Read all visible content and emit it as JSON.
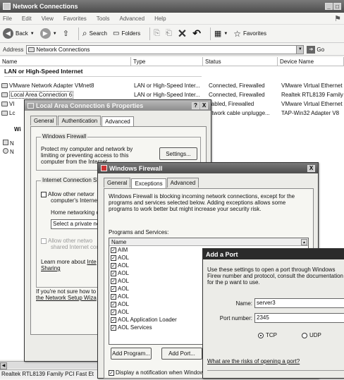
{
  "window": {
    "title": "Network Connections"
  },
  "menu": [
    "File",
    "Edit",
    "View",
    "Favorites",
    "Tools",
    "Advanced",
    "Help"
  ],
  "toolbar": {
    "back": "Back",
    "search": "Search",
    "folders": "Folders",
    "favorites": "Favorites"
  },
  "address": {
    "label": "Address",
    "value": "Network Connections",
    "go": "Go"
  },
  "list": {
    "headers": [
      "Name",
      "Type",
      "Status",
      "Device Name"
    ],
    "group": "LAN or High-Speed Internet",
    "rows": [
      {
        "name": "VMware Network Adapter VMnet8",
        "type": "LAN or High-Speed Inter...",
        "status": "Connected, Firewalled",
        "device": "VMware Virtual Ethernet"
      },
      {
        "name": "Local Area Connection 6",
        "type": "LAN or High-Speed Inter...",
        "status": "Connected, Firewalled",
        "device": "Realtek RTL8139 Family ..."
      },
      {
        "name": "VI",
        "type": "",
        "status": "isabled, Firewalled",
        "device": "VMware Virtual Ethernet"
      },
      {
        "name": "Lc",
        "type": "",
        "status": "etwork cable unplugge...",
        "device": "TAP-Win32 Adapter V8"
      }
    ],
    "wizard_partial": "Wi",
    "partial1": "N",
    "partial2": "N"
  },
  "statusbar": "Realtek RTL8139 Family PCI Fast Et",
  "props": {
    "title": "Local Area Connection 6 Properties",
    "help_btn": "?",
    "close_btn": "X",
    "tabs": [
      "General",
      "Authentication",
      "Advanced"
    ],
    "fw_group": "Windows Firewall",
    "fw_text": "Protect my computer and network by limiting or preventing access to this computer from the Internet",
    "settings_btn": "Settings...",
    "ics_group": "Internet Connection Sh",
    "allow1": "Allow other networ",
    "allow1b": "computer's Internet",
    "home": "Home networking c",
    "select": "Select a private ne",
    "allow2": "Allow other netwo",
    "allow2b": "shared Internet con",
    "learn": "Learn more about",
    "learn_link": "Inte",
    "sharing": "Sharing",
    "notsure": "If you're not sure how to",
    "wizard_link": "the Network Setup Wiza"
  },
  "firewall": {
    "title": "Windows Firewall",
    "close_btn": "X",
    "tabs": [
      "General",
      "Exceptions",
      "Advanced"
    ],
    "desc": "Windows Firewall is blocking incoming network connections, except for the programs and services selected below. Adding exceptions allows some programs to work better but might increase your security risk.",
    "programs_label": "Programs and Services:",
    "col_name": "Name",
    "programs": [
      "AIM",
      "AOL",
      "AOL",
      "AOL",
      "AOL",
      "AOL",
      "AOL",
      "AOL",
      "AOL",
      "AOL Application Loader",
      "AOL Services"
    ],
    "add_program": "Add Program...",
    "add_port": "Add Port...",
    "notify": "Display a notification when Window"
  },
  "addport": {
    "title": "Add a Port",
    "desc": "Use these settings to open a port through Windows Firew number and protocol, consult the documentation for the p want to use.",
    "name_label": "Name:",
    "name_value": "server3",
    "port_label": "Port number:",
    "port_value": "2345",
    "tcp": "TCP",
    "udp": "UDP",
    "risk_link": "What are the risks of opening a port?"
  }
}
